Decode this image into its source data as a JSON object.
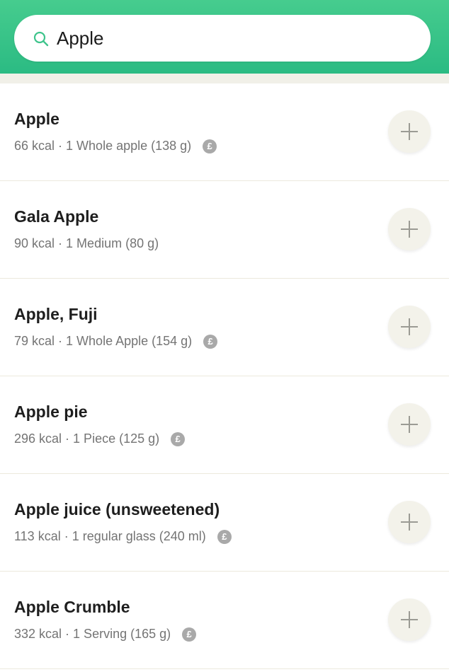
{
  "search": {
    "value": "Apple",
    "icon": "search-icon",
    "icon_color": "#3fc48c"
  },
  "theme": {
    "header_color": "#3cc68b",
    "add_button_bg": "#f3f2ea",
    "badge_color": "#a9a9a9"
  },
  "results": [
    {
      "name": "Apple",
      "kcal": "66 kcal",
      "serving": "1 Whole apple (138 g)",
      "badge": "£"
    },
    {
      "name": "Gala Apple",
      "kcal": "90 kcal",
      "serving": "1 Medium (80 g)",
      "badge": ""
    },
    {
      "name": "Apple, Fuji",
      "kcal": "79 kcal",
      "serving": "1 Whole Apple (154 g)",
      "badge": "£"
    },
    {
      "name": "Apple pie",
      "kcal": "296 kcal",
      "serving": "1 Piece (125 g)",
      "badge": "£"
    },
    {
      "name": "Apple juice (unsweetened)",
      "kcal": "113 kcal",
      "serving": "1 regular glass (240 ml)",
      "badge": "£"
    },
    {
      "name": "Apple Crumble",
      "kcal": "332 kcal",
      "serving": "1 Serving (165 g)",
      "badge": "£"
    }
  ],
  "separator": " · ",
  "add_icon": "plus-icon"
}
